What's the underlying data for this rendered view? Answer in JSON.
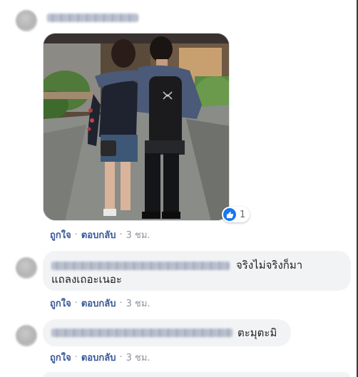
{
  "comments": [
    {
      "text": "",
      "reactions": {
        "count": "1",
        "icon": "like-icon"
      },
      "actions": {
        "like": "ถูกใจ",
        "reply": "ตอบกลับ",
        "time": "3 ชม."
      }
    },
    {
      "text_line1": "จริงไม่จริงก็มา",
      "text_line2": "แถลงเถอะเนอะ",
      "actions": {
        "like": "ถูกใจ",
        "reply": "ตอบกลับ",
        "time": "3 ชม."
      }
    },
    {
      "text": "ตะมุตะมิ",
      "actions": {
        "like": "ถูกใจ",
        "reply": "ตอบกลับ",
        "time": "3 ชม."
      }
    }
  ],
  "separator": "·",
  "colors": {
    "link": "#385898",
    "bubble": "#f2f3f5",
    "like": "#1877f2",
    "meta": "#90949c"
  }
}
